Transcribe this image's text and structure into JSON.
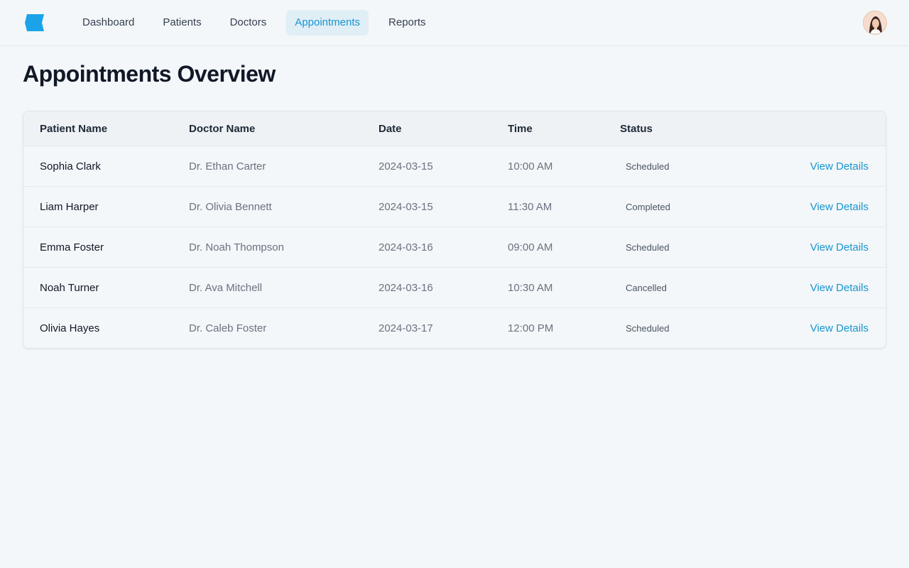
{
  "colors": {
    "accent": "#1895d1",
    "logo": "#1aa3e8",
    "background": "#f3f7f9",
    "active_nav_bg": "#e0eef6"
  },
  "header": {
    "logo_icon": "brand-logo-icon",
    "nav": [
      {
        "label": "Dashboard",
        "active": false
      },
      {
        "label": "Patients",
        "active": false
      },
      {
        "label": "Doctors",
        "active": false
      },
      {
        "label": "Appointments",
        "active": true
      },
      {
        "label": "Reports",
        "active": false
      }
    ],
    "avatar_icon": "user-avatar"
  },
  "main": {
    "title": "Appointments Overview",
    "table": {
      "columns": [
        "Patient Name",
        "Doctor Name",
        "Date",
        "Time",
        "Status"
      ],
      "rows": [
        {
          "patient": "Sophia Clark",
          "doctor": "Dr. Ethan Carter",
          "date": "2024-03-15",
          "time": "10:00 AM",
          "status": "Scheduled",
          "action": "View Details"
        },
        {
          "patient": "Liam Harper",
          "doctor": "Dr. Olivia Bennett",
          "date": "2024-03-15",
          "time": "11:30 AM",
          "status": "Completed",
          "action": "View Details"
        },
        {
          "patient": "Emma Foster",
          "doctor": "Dr. Noah Thompson",
          "date": "2024-03-16",
          "time": "09:00 AM",
          "status": "Scheduled",
          "action": "View Details"
        },
        {
          "patient": "Noah Turner",
          "doctor": "Dr. Ava Mitchell",
          "date": "2024-03-16",
          "time": "10:30 AM",
          "status": "Cancelled",
          "action": "View Details"
        },
        {
          "patient": "Olivia Hayes",
          "doctor": "Dr. Caleb Foster",
          "date": "2024-03-17",
          "time": "12:00 PM",
          "status": "Scheduled",
          "action": "View Details"
        }
      ]
    }
  }
}
